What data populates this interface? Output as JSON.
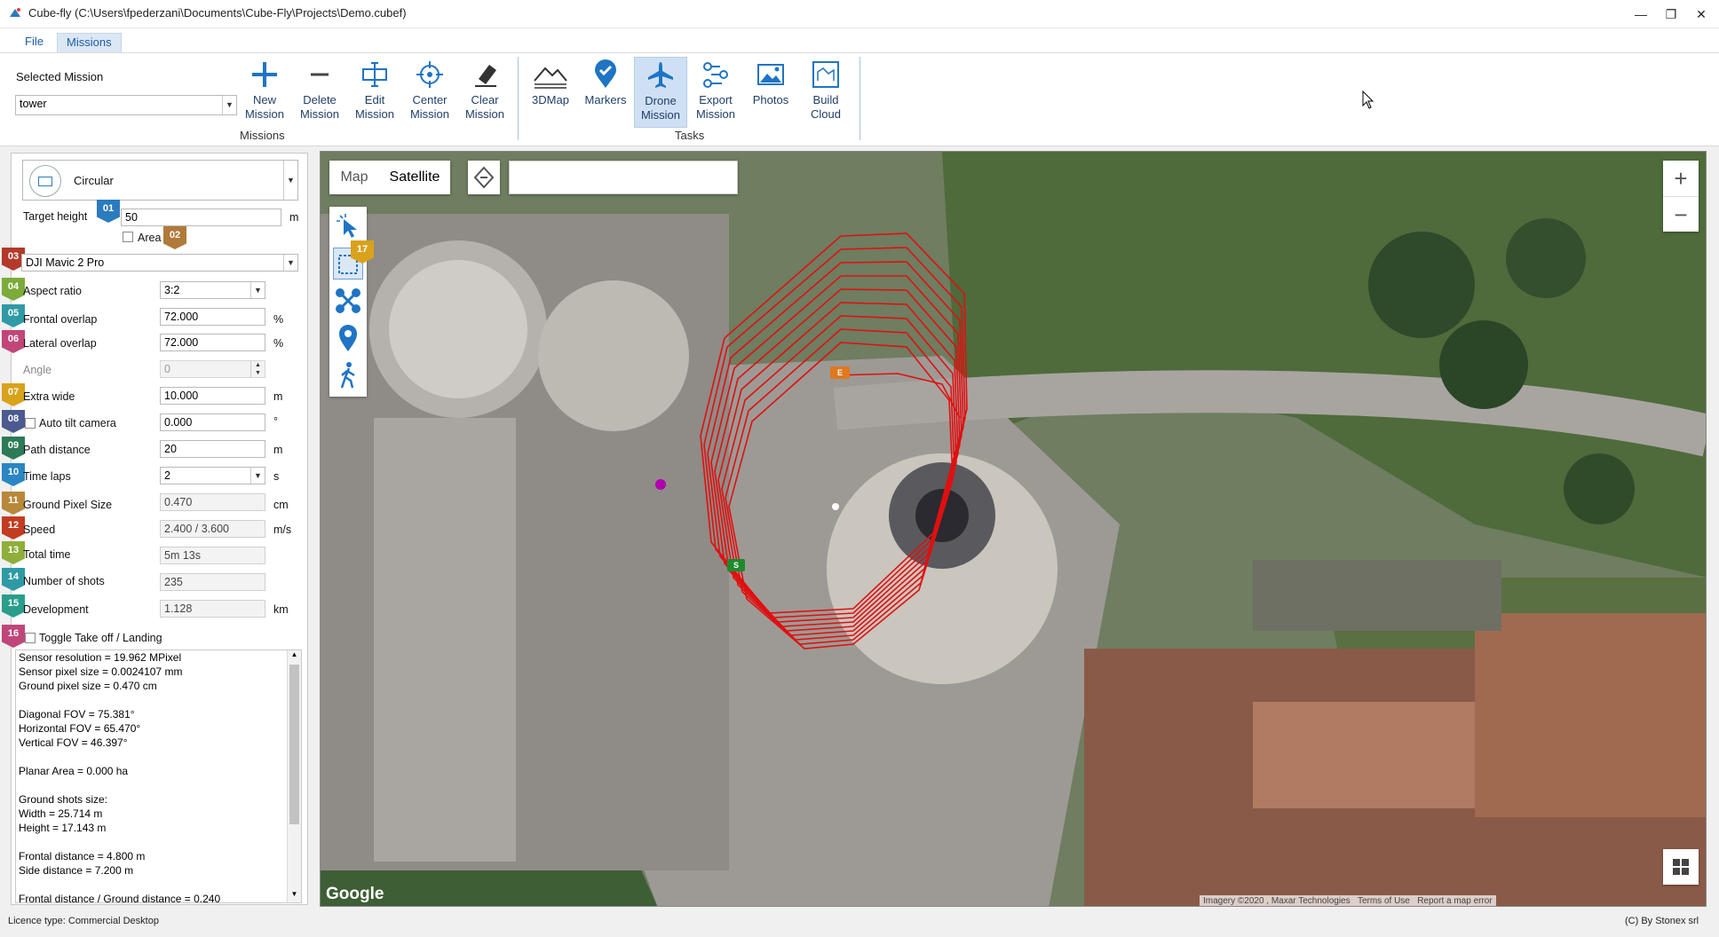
{
  "window": {
    "title": "Cube-fly (C:\\Users\\fpederzani\\Documents\\Cube-Fly\\Projects\\Demo.cubef)",
    "controls": [
      "minimize-icon",
      "restore-icon",
      "close-icon"
    ]
  },
  "menu": {
    "tabs": [
      {
        "label": "File"
      },
      {
        "label": "Missions",
        "active": true
      }
    ]
  },
  "ribbon": {
    "selected_mission_label": "Selected Mission",
    "selected_mission_value": "tower",
    "missions_group": {
      "label": "Missions",
      "buttons": [
        {
          "label1": "New",
          "label2": "Mission",
          "icon": "plus-icon"
        },
        {
          "label1": "Delete",
          "label2": "Mission",
          "icon": "minus-icon"
        },
        {
          "label1": "Edit",
          "label2": "Mission",
          "icon": "edit-icon"
        },
        {
          "label1": "Center",
          "label2": "Mission",
          "icon": "crosshair-icon"
        },
        {
          "label1": "Clear",
          "label2": "Mission",
          "icon": "eraser-icon"
        }
      ]
    },
    "tasks_group": {
      "label": "Tasks",
      "buttons": [
        {
          "label1": "3DMap",
          "label2": "",
          "icon": "terrain-icon"
        },
        {
          "label1": "Markers",
          "label2": "",
          "icon": "marker-icon"
        },
        {
          "label1": "Drone",
          "label2": "Mission",
          "icon": "airplane-icon",
          "active": true
        },
        {
          "label1": "Export",
          "label2": "Mission",
          "icon": "export-route-icon"
        },
        {
          "label1": "Photos",
          "label2": "",
          "icon": "photo-icon"
        },
        {
          "label1": "Build",
          "label2": "Cloud",
          "icon": "build-cloud-icon"
        }
      ]
    }
  },
  "panel": {
    "mission_type": "Circular",
    "target_height": {
      "label": "Target height",
      "value": "50",
      "unit": "m",
      "badge": "01",
      "badge_color": "#2b7bbf"
    },
    "area": {
      "label": "Area",
      "checked": false,
      "badge": "02",
      "badge_color": "#b07a3a"
    },
    "drone": {
      "value": "DJI Mavic 2 Pro",
      "badge": "03",
      "badge_color": "#b33a2a"
    },
    "fields": [
      {
        "badge": "04",
        "badge_color": "#7cab3a",
        "label": "Aspect ratio",
        "value": "3:2",
        "type": "dropdown",
        "unit": ""
      },
      {
        "badge": "05",
        "badge_color": "#2f9aa5",
        "label": "Frontal overlap",
        "value": "72.000",
        "type": "input",
        "unit": "%"
      },
      {
        "badge": "06",
        "badge_color": "#c0467a",
        "label": "Lateral overlap",
        "value": "72.000",
        "type": "input",
        "unit": "%"
      },
      {
        "badge": "",
        "badge_color": "",
        "label": "Angle",
        "value": "0",
        "type": "spin-disabled",
        "unit": ""
      },
      {
        "badge": "07",
        "badge_color": "#d9a21b",
        "label": "Extra wide",
        "value": "10.000",
        "type": "input",
        "unit": "m"
      },
      {
        "badge": "08",
        "badge_color": "#4b5a8f",
        "label": "Auto tilt camera",
        "value": "0.000",
        "type": "input-check",
        "unit": "°"
      },
      {
        "badge": "09",
        "badge_color": "#2d7a56",
        "label": "Path distance",
        "value": "20",
        "type": "input",
        "unit": "m"
      },
      {
        "badge": "10",
        "badge_color": "#2a86c2",
        "label": "Time laps",
        "value": "2",
        "type": "dropdown",
        "unit": "s"
      },
      {
        "badge": "11",
        "badge_color": "#b8883a",
        "label": "Ground Pixel Size",
        "value": "0.470",
        "type": "readonly",
        "unit": "cm"
      },
      {
        "badge": "12",
        "badge_color": "#c23c22",
        "label": "Speed",
        "value": "2.400 / 3.600",
        "type": "readonly",
        "unit": "m/s"
      },
      {
        "badge": "13",
        "badge_color": "#8fae3b",
        "label": "Total time",
        "value": "5m 13s",
        "type": "readonly",
        "unit": ""
      },
      {
        "badge": "14",
        "badge_color": "#2f9aa5",
        "label": "Number of shots",
        "value": "235",
        "type": "readonly",
        "unit": ""
      },
      {
        "badge": "15",
        "badge_color": "#2a9e8a",
        "label": "Development",
        "value": "1.128",
        "type": "readonly",
        "unit": "km"
      }
    ],
    "toggle": {
      "badge": "16",
      "badge_color": "#c0467a",
      "label": "Toggle Take off / Landing",
      "checked": false
    },
    "info_lines": [
      "Sensor resolution = 19.962 MPixel",
      "Sensor pixel size = 0.0024107 mm",
      "Ground pixel size = 0.470 cm",
      "",
      "Diagonal FOV = 75.381°",
      "Horizontal FOV = 65.470°",
      "Vertical FOV = 46.397°",
      "",
      "Planar Area = 0.000 ha",
      "",
      "Ground shots size:",
      "Width = 25.714 m",
      "Height = 17.143 m",
      "",
      "Frontal distance = 4.800 m",
      "Side distance = 7.200 m",
      "",
      "Frontal distance / Ground distance = 0.240"
    ]
  },
  "map": {
    "map_tab": "Map",
    "satellite_tab": "Satellite",
    "search_value": "",
    "tools_badge": "17",
    "tools_badge_color": "#d9a21b",
    "tools": [
      "select-arrow-icon",
      "polygon-area-icon",
      "drone-icon",
      "location-pin-icon",
      "walking-person-icon"
    ],
    "zoom_in": "+",
    "zoom_out": "−",
    "google_logo": "Google",
    "attribution": [
      "Imagery ©2020 , Maxar Technologies",
      "Terms of Use",
      "Report a map error"
    ],
    "start_marker": "S",
    "end_marker": "E",
    "path_color": "#e01010"
  },
  "status": {
    "licence": "Licence type: Commercial Desktop",
    "copyright": "(C) By Stonex srl"
  }
}
